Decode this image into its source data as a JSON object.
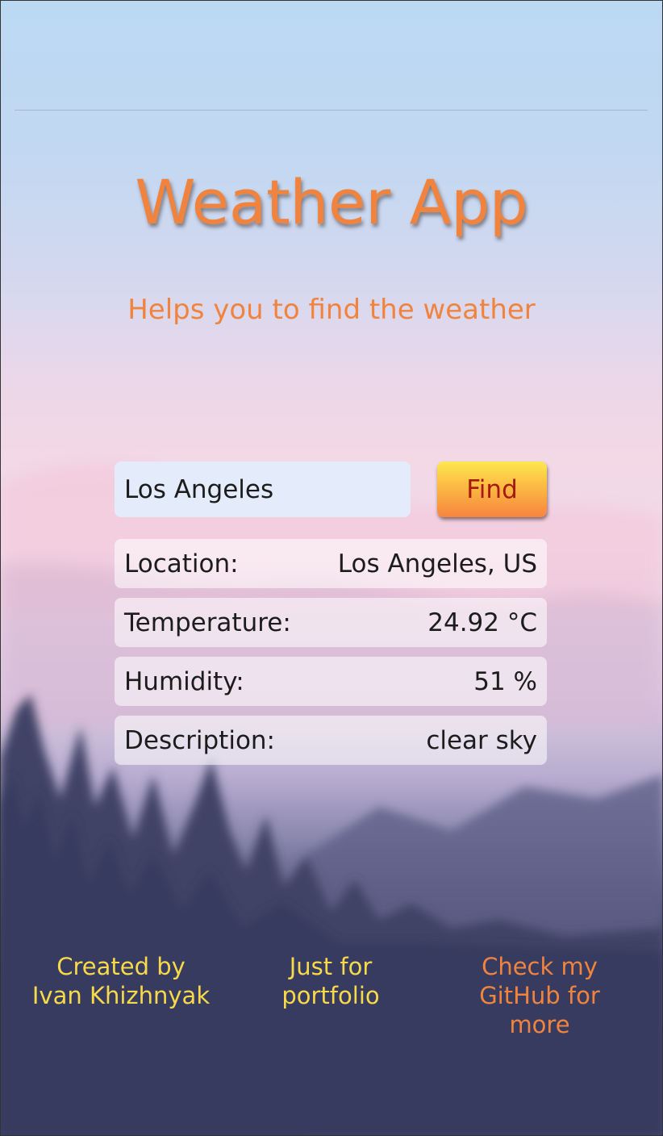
{
  "header": {
    "title": "Weather App",
    "subtitle": "Helps you to find the weather"
  },
  "search": {
    "value": "Los Angeles",
    "button_label": "Find"
  },
  "results": [
    {
      "label": "Location:",
      "value": "Los Angeles, US"
    },
    {
      "label": "Temperature:",
      "value": "24.92 °C"
    },
    {
      "label": "Humidity:",
      "value": "51 %"
    },
    {
      "label": "Description:",
      "value": "clear sky"
    }
  ],
  "footer": {
    "created_line1": "Created by",
    "created_line2": "Ivan Khizhnyak",
    "portfolio_line1": "Just for",
    "portfolio_line2": "portfolio",
    "github_line1": "Check my",
    "github_line2": "GitHub for",
    "github_line3": "more"
  },
  "colors": {
    "accent_orange": "#f0843e",
    "footer_yellow": "#f7d94a",
    "button_text": "#a81a10"
  }
}
